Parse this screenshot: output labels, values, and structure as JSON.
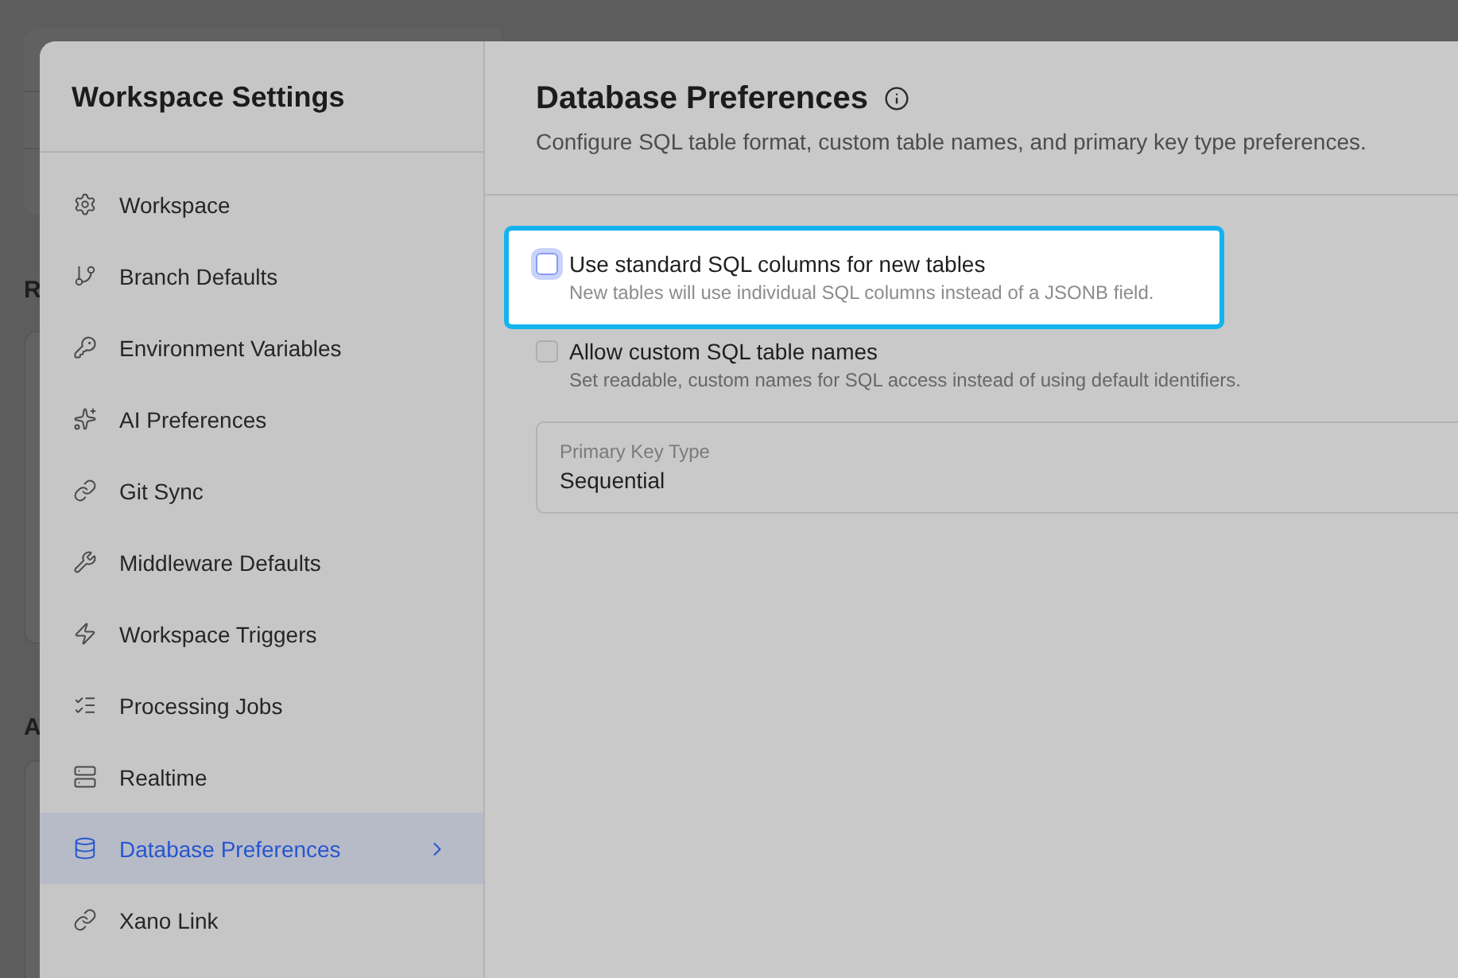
{
  "background": {
    "headings": [
      "R",
      "A"
    ]
  },
  "dialog": {
    "sidebar": {
      "title": "Workspace Settings",
      "items": [
        {
          "label": "Workspace",
          "selected": false
        },
        {
          "label": "Branch Defaults",
          "selected": false
        },
        {
          "label": "Environment Variables",
          "selected": false
        },
        {
          "label": "AI Preferences",
          "selected": false
        },
        {
          "label": "Git Sync",
          "selected": false
        },
        {
          "label": "Middleware Defaults",
          "selected": false
        },
        {
          "label": "Workspace Triggers",
          "selected": false
        },
        {
          "label": "Processing Jobs",
          "selected": false
        },
        {
          "label": "Realtime",
          "selected": false
        },
        {
          "label": "Database Preferences",
          "selected": true
        },
        {
          "label": "Xano Link",
          "selected": false
        }
      ]
    },
    "main": {
      "title": "Database Preferences",
      "description": "Configure SQL table format, custom table names, and primary key type preferences.",
      "options": [
        {
          "label": "Use standard SQL columns for new tables",
          "description": "New tables will use individual SQL columns instead of a JSONB field.",
          "checked": false,
          "highlighted": true
        },
        {
          "label": "Allow custom SQL table names",
          "description": "Set readable, custom names for SQL access instead of using default identifiers.",
          "checked": false,
          "highlighted": false
        }
      ],
      "select": {
        "label": "Primary Key Type",
        "value": "Sequential"
      }
    }
  }
}
